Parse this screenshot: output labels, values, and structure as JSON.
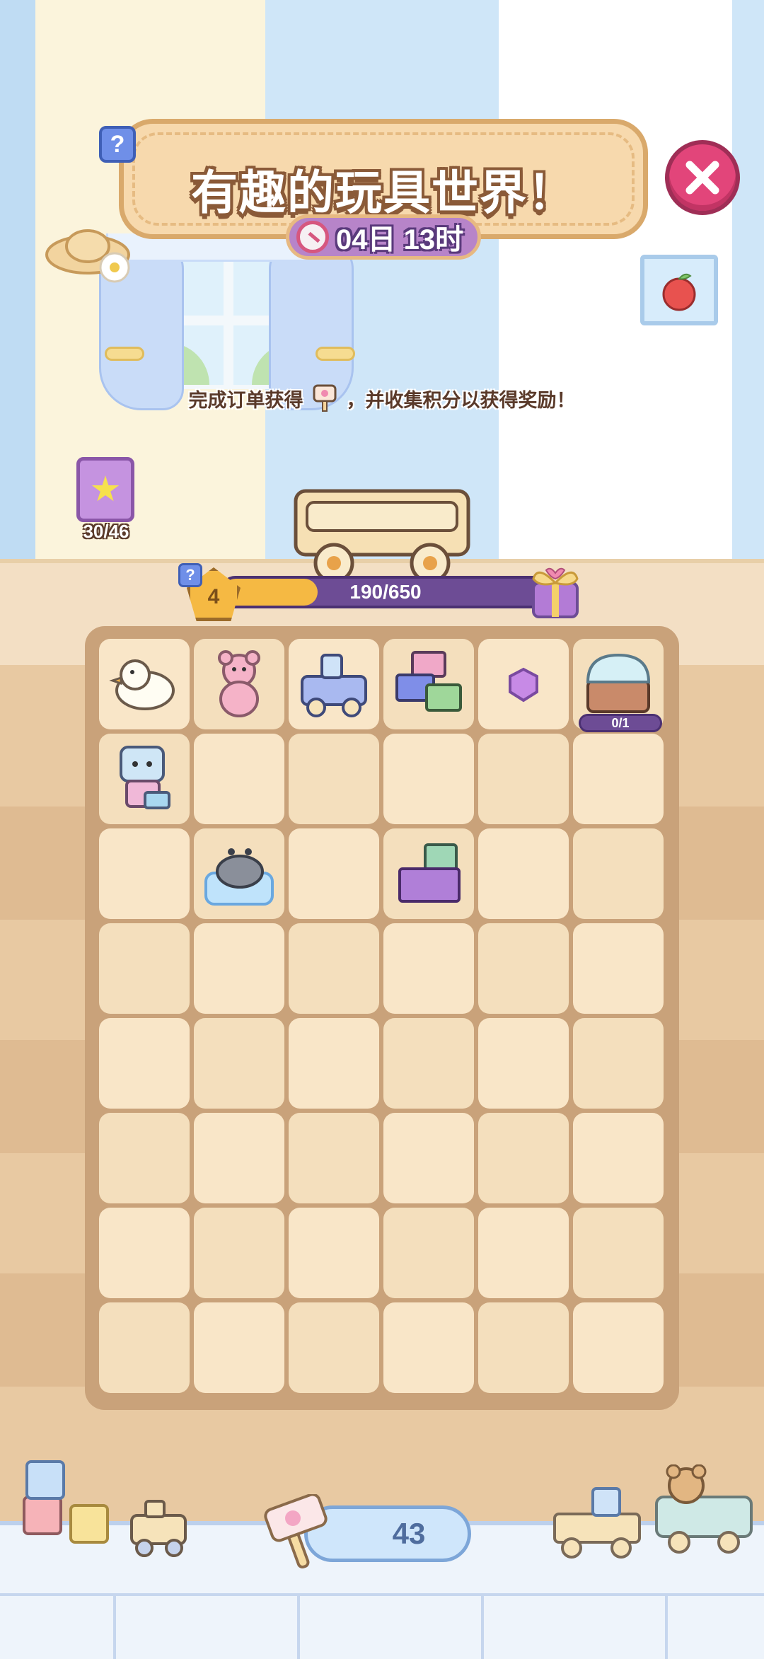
{
  "header": {
    "title": "有趣的玩具世界！",
    "timer": "04日 13时",
    "help_label": "?",
    "subtitle_before": "完成订单获得",
    "subtitle_after": "，并收集积分以获得奖励！"
  },
  "collection_book": {
    "count": "30/46"
  },
  "progress": {
    "level": "4",
    "text": "190/650",
    "current": 190,
    "max": 650,
    "help_label": "?"
  },
  "board": {
    "rows": 8,
    "cols": 6,
    "items": [
      {
        "row": 0,
        "col": 0,
        "item": "duck-toy"
      },
      {
        "row": 0,
        "col": 1,
        "item": "teddy-bear"
      },
      {
        "row": 0,
        "col": 2,
        "item": "toy-train"
      },
      {
        "row": 0,
        "col": 3,
        "item": "building-blocks-large"
      },
      {
        "row": 0,
        "col": 4,
        "item": "purple-gem"
      },
      {
        "row": 0,
        "col": 5,
        "item": "toy-chest",
        "badge": "0/1"
      },
      {
        "row": 1,
        "col": 0,
        "item": "robot-toy"
      },
      {
        "row": 2,
        "col": 1,
        "item": "bath-toy"
      },
      {
        "row": 2,
        "col": 3,
        "item": "building-blocks-small"
      }
    ]
  },
  "footer": {
    "hammer_count": "43"
  },
  "colors": {
    "accent_purple": "#6d4c95",
    "progress_fill": "#f5b943",
    "close_red": "#e2457a",
    "board_frame": "#c9a27a"
  }
}
